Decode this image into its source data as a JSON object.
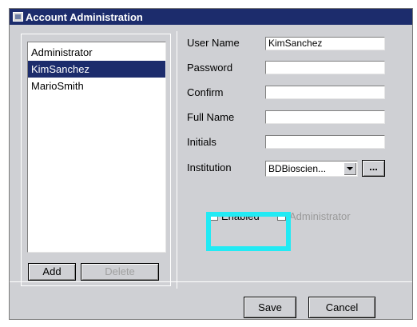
{
  "window": {
    "title": "Account Administration"
  },
  "users": {
    "items": [
      "Administrator",
      "KimSanchez",
      "MarioSmith"
    ],
    "selected": "KimSanchez"
  },
  "list_buttons": {
    "add": "Add",
    "delete": "Delete"
  },
  "form": {
    "user_name_label": "User Name",
    "user_name_value": "KimSanchez",
    "password_label": "Password",
    "password_value": "",
    "confirm_label": "Confirm",
    "confirm_value": "",
    "full_name_label": "Full Name",
    "full_name_value": "",
    "initials_label": "Initials",
    "initials_value": "",
    "institution_label": "Institution",
    "institution_value": "BDBioscien...",
    "browse_label": "...",
    "enabled_label": "Enabled",
    "enabled_checked": false,
    "administrator_label": "Administrator",
    "administrator_checked": false
  },
  "dialog_buttons": {
    "save": "Save",
    "cancel": "Cancel"
  },
  "colors": {
    "title_bar": "#1c2c6c",
    "highlight_rect": "#22eaf4"
  }
}
